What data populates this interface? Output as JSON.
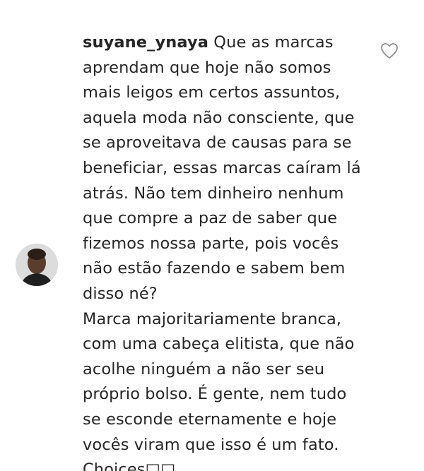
{
  "comment": {
    "username": "suyane_ynaya",
    "text": "Que as marcas\naprendam que hoje não somos\nmais leigos em certos assuntos,\naquela moda não consciente, que\nse aproveitava de causas para se\nbeneficiar, essas marcas caíram lá\natrás. Não tem dinheiro nenhum\nque compre a paz de saber que\nfizemos nossa parte, pois vocês\nnão estão fazendo e sabem bem\ndisso né?\nMarca majoritariamente branca,\ncom uma cabeça elitista, que não\nacolhe ninguém a não ser seu\npróprio bolso. É gente, nem tudo\nse esconde eternamente e hoje\nvocês viram que isso é um fato.\nChoices□□",
    "like_icon": "heart-outline-icon",
    "avatar": "user-avatar"
  },
  "colors": {
    "text": "#262626",
    "background": "#ffffff",
    "icon": "#8e8e8e"
  }
}
